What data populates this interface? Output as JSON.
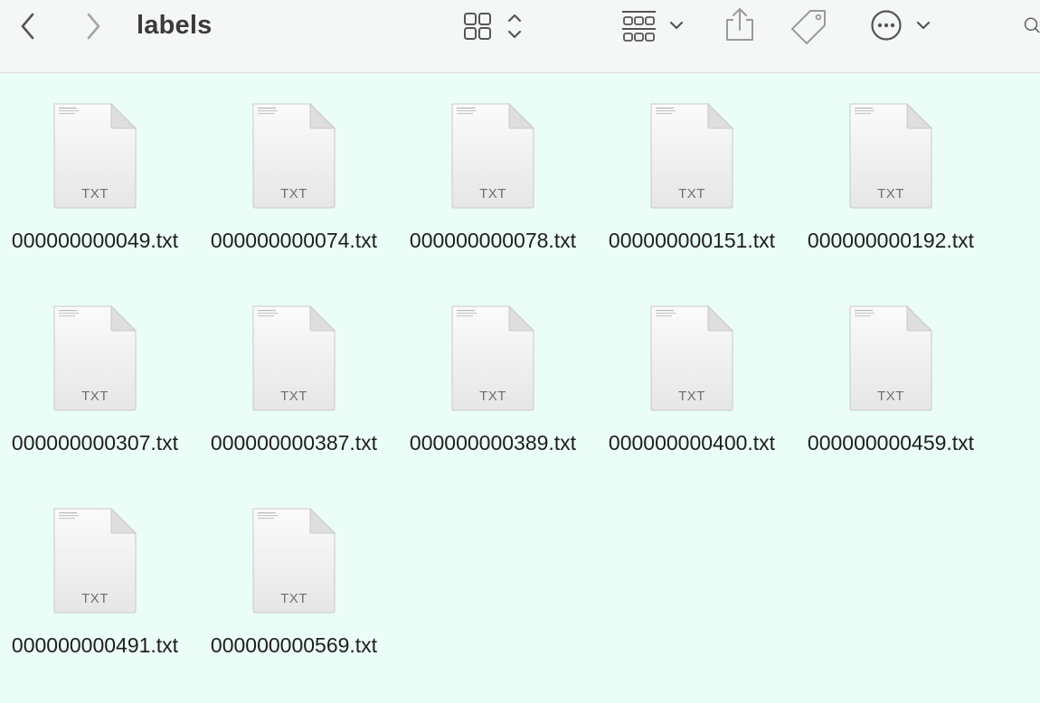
{
  "window": {
    "title": "labels"
  },
  "toolbar": {
    "back_icon": "chevron-left-icon",
    "forward_icon": "chevron-right-icon",
    "view_icon": "icon-grid-view-icon",
    "group_icon": "group-by-icon",
    "share_icon": "share-icon",
    "tag_icon": "tag-icon",
    "more_icon": "ellipsis-circle-icon",
    "search_icon": "search-icon"
  },
  "files": [
    {
      "name": "000000000049.txt",
      "type": "TXT"
    },
    {
      "name": "000000000074.txt",
      "type": "TXT"
    },
    {
      "name": "000000000078.txt",
      "type": "TXT"
    },
    {
      "name": "000000000151.txt",
      "type": "TXT"
    },
    {
      "name": "000000000192.txt",
      "type": "TXT"
    },
    {
      "name": "000000000307.txt",
      "type": "TXT"
    },
    {
      "name": "000000000387.txt",
      "type": "TXT"
    },
    {
      "name": "000000000389.txt",
      "type": "TXT"
    },
    {
      "name": "000000000400.txt",
      "type": "TXT"
    },
    {
      "name": "000000000459.txt",
      "type": "TXT"
    },
    {
      "name": "000000000491.txt",
      "type": "TXT"
    },
    {
      "name": "000000000569.txt",
      "type": "TXT"
    }
  ]
}
